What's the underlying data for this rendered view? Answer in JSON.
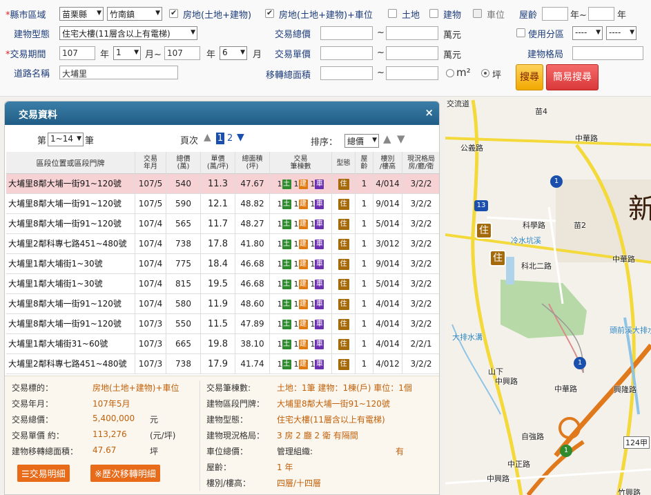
{
  "search": {
    "county_label": "縣市區域",
    "county_value": "苗栗縣",
    "town_value": "竹南鎮",
    "checks": [
      {
        "label": "房地(土地+建物)",
        "checked": true,
        "disabled": false
      },
      {
        "label": "房地(土地+建物)+車位",
        "checked": true,
        "disabled": false
      },
      {
        "label": "土地",
        "checked": false,
        "disabled": false
      },
      {
        "label": "建物",
        "checked": false,
        "disabled": false
      },
      {
        "label": "車位",
        "checked": false,
        "disabled": true
      }
    ],
    "age_label": "屋齡",
    "age_from": "",
    "age_sep": "年~",
    "age_to": "",
    "age_unit": "年",
    "building_type_label": "建物型態",
    "building_type_value": "住宅大樓(11層含以上有電梯)",
    "total_price_label": "交易總價",
    "tilde": "~",
    "wan_unit": "萬元",
    "zoning_label": "使用分區",
    "zoning_opt1": "----",
    "zoning_opt2": "----",
    "period_label": "交易期間",
    "period_from_year": "107",
    "year_unit": "年",
    "period_from_month": "1",
    "month_sep": "月~",
    "period_to_year": "107",
    "period_to_month": "6",
    "month_unit": "月",
    "unit_price_label": "交易單價",
    "layout_label": "建物格局",
    "road_label": "道路名稱",
    "road_value": "大埔里",
    "area_label": "移轉總面積",
    "m2": "m²",
    "ping": "坪",
    "search_btn": "搜尋",
    "simple_search_btn": "簡易搜尋"
  },
  "panel": {
    "title": "交易資料",
    "close": "×",
    "page_prefix": "第",
    "page_select": "1~14",
    "page_suffix": "筆",
    "pages_label": "頁次",
    "page1": "1",
    "page2": "2",
    "sort_label": "排序：",
    "sort_value": "總價"
  },
  "table": {
    "headers": [
      "區段位置或區段門牌",
      "交易\n年月",
      "總價\n(萬)",
      "單價\n(萬/坪)",
      "總面積\n(坪)",
      "交易\n筆棟數",
      "型態",
      "屋\n齡",
      "樓別\n/樓高",
      "現況格局\n房/廳/衛"
    ],
    "rows": [
      {
        "addr": "大埔里8鄰大埔一街91~120號",
        "ym": "107/5",
        "total": "540",
        "unit": "11.3",
        "area": "47.67",
        "type": "住",
        "age": "1",
        "floor": "4/014",
        "layout": "3/2/2"
      },
      {
        "addr": "大埔里8鄰大埔一街91~120號",
        "ym": "107/5",
        "total": "590",
        "unit": "12.1",
        "area": "48.82",
        "type": "住",
        "age": "1",
        "floor": "9/014",
        "layout": "3/2/2"
      },
      {
        "addr": "大埔里8鄰大埔一街91~120號",
        "ym": "107/4",
        "total": "565",
        "unit": "11.7",
        "area": "48.27",
        "type": "住",
        "age": "1",
        "floor": "5/014",
        "layout": "3/2/2"
      },
      {
        "addr": "大埔里2鄰科專七路451~480號",
        "ym": "107/4",
        "total": "738",
        "unit": "17.8",
        "area": "41.80",
        "type": "住",
        "age": "1",
        "floor": "3/012",
        "layout": "3/2/2"
      },
      {
        "addr": "大埔里1鄰大埔街1~30號",
        "ym": "107/4",
        "total": "775",
        "unit": "18.4",
        "area": "46.68",
        "type": "住",
        "age": "1",
        "floor": "9/014",
        "layout": "3/2/2"
      },
      {
        "addr": "大埔里1鄰大埔街1~30號",
        "ym": "107/4",
        "total": "815",
        "unit": "19.5",
        "area": "46.68",
        "type": "住",
        "age": "1",
        "floor": "5/014",
        "layout": "3/2/2"
      },
      {
        "addr": "大埔里8鄰大埔一街91~120號",
        "ym": "107/4",
        "total": "580",
        "unit": "11.9",
        "area": "48.60",
        "type": "住",
        "age": "1",
        "floor": "4/014",
        "layout": "3/2/2"
      },
      {
        "addr": "大埔里8鄰大埔一街91~120號",
        "ym": "107/3",
        "total": "550",
        "unit": "11.5",
        "area": "47.89",
        "type": "住",
        "age": "1",
        "floor": "4/014",
        "layout": "3/2/2"
      },
      {
        "addr": "大埔里1鄰大埔街31~60號",
        "ym": "107/3",
        "total": "665",
        "unit": "19.8",
        "area": "38.10",
        "type": "住",
        "age": "1",
        "floor": "4/014",
        "layout": "2/2/1"
      },
      {
        "addr": "大埔里2鄰科專七路451~480號",
        "ym": "107/3",
        "total": "738",
        "unit": "17.9",
        "area": "41.74",
        "type": "住",
        "age": "1",
        "floor": "4/012",
        "layout": "3/2/2"
      }
    ],
    "tag_one": "1",
    "tag_land": "土",
    "tag_bldg": "建",
    "tag_car": "車"
  },
  "detail": {
    "left": [
      {
        "label": "交易標的：",
        "value": "房地(土地+建物)+車位",
        "unit": ""
      },
      {
        "label": "交易年月：",
        "value": "107年5月",
        "unit": ""
      },
      {
        "label": "交易總價：",
        "value": "5,400,000",
        "unit": "元"
      },
      {
        "label": "交易單價 約：",
        "value": "113,276",
        "unit": "(元/坪)"
      },
      {
        "label": "建物移轉總面積：",
        "value": "47.67",
        "unit": "坪"
      }
    ],
    "right": [
      {
        "label": "交易筆棟數:",
        "value": "土地：1筆 建物：1棟(戶) 車位：1個"
      },
      {
        "label": "建物區段門牌：",
        "value": "大埔里8鄰大埔一街91~120號"
      },
      {
        "label": "建物型態：",
        "value": "住宅大樓(11層含以上有電梯)"
      },
      {
        "label": "建物現況格局：",
        "value": "3 房 2 廳 2 衛 有隔間"
      },
      {
        "label": "車位總價：",
        "value": ""
      },
      {
        "label": "屋齡：",
        "value": "1 年"
      },
      {
        "label": "樓別/樓高：",
        "value": "四層/十四層"
      }
    ],
    "mgmt_label": "管理組織:",
    "mgmt_value": "有",
    "btn_detail": "交易明細",
    "btn_history": "※歷次移轉明細"
  },
  "map": {
    "labels": [
      "公義路",
      "中華路",
      "苗4",
      "科學路",
      "苗2",
      "科北二路",
      "冷水坑溪",
      "中華路",
      "大排水溝",
      "中興路",
      "山下",
      "中華路",
      "自強路",
      "中正路",
      "中興路",
      "124甲",
      "興隆路",
      "頭前溪大排水溝",
      "竹興路",
      "交流道",
      "新"
    ],
    "route_1": "1",
    "route_13": "13",
    "marker": "住"
  }
}
